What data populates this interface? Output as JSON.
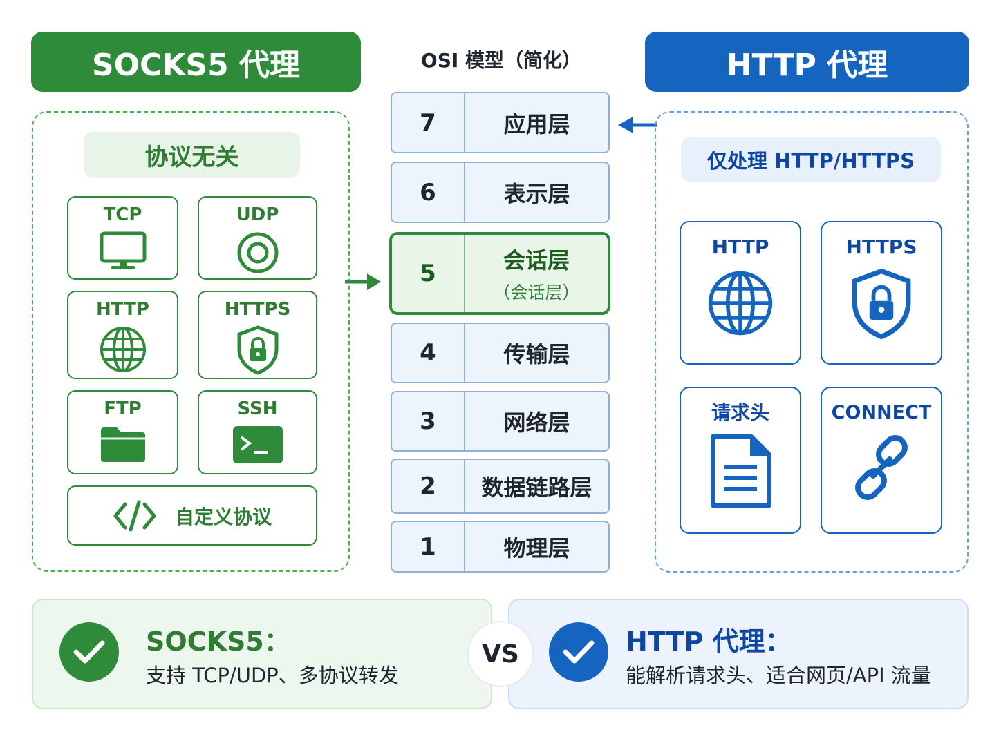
{
  "headers": {
    "socks5": "SOCKS5 代理",
    "osi": "OSI 模型（简化）",
    "http": "HTTP 代理"
  },
  "socks5_panel": {
    "pill": "协议无关",
    "tiles": [
      {
        "label": "TCP",
        "icon": "monitor-icon"
      },
      {
        "label": "UDP",
        "icon": "target-icon"
      },
      {
        "label": "HTTP",
        "icon": "globe-icon"
      },
      {
        "label": "HTTPS",
        "icon": "shield-lock-icon"
      },
      {
        "label": "FTP",
        "icon": "folder-icon"
      },
      {
        "label": "SSH",
        "icon": "terminal-icon"
      }
    ],
    "custom": {
      "label": "自定义协议",
      "icon": "code-icon"
    }
  },
  "osi_layers": [
    {
      "num": "7",
      "name": "应用层"
    },
    {
      "num": "6",
      "name": "表示层"
    },
    {
      "num": "5",
      "name": "会话层",
      "sub": "（会话层）"
    },
    {
      "num": "4",
      "name": "传输层"
    },
    {
      "num": "3",
      "name": "网络层"
    },
    {
      "num": "2",
      "name": "数据链路层"
    },
    {
      "num": "1",
      "name": "物理层"
    }
  ],
  "http_panel": {
    "pill": "仅处理 HTTP/HTTPS",
    "tiles": [
      {
        "label": "HTTP",
        "icon": "globe-icon"
      },
      {
        "label": "HTTPS",
        "icon": "shield-lock-icon"
      },
      {
        "label": "请求头",
        "icon": "document-icon"
      },
      {
        "label": "CONNECT",
        "icon": "link-icon"
      }
    ]
  },
  "comparison": {
    "socks5": {
      "title": "SOCKS5：",
      "desc": "支持 TCP/UDP、多协议转发"
    },
    "vs": "VS",
    "http": {
      "title": "HTTP 代理：",
      "desc": "能解析请求头、适合网页/API 流量"
    }
  },
  "colors": {
    "green": "#2e8b3a",
    "blue": "#1565c0"
  }
}
